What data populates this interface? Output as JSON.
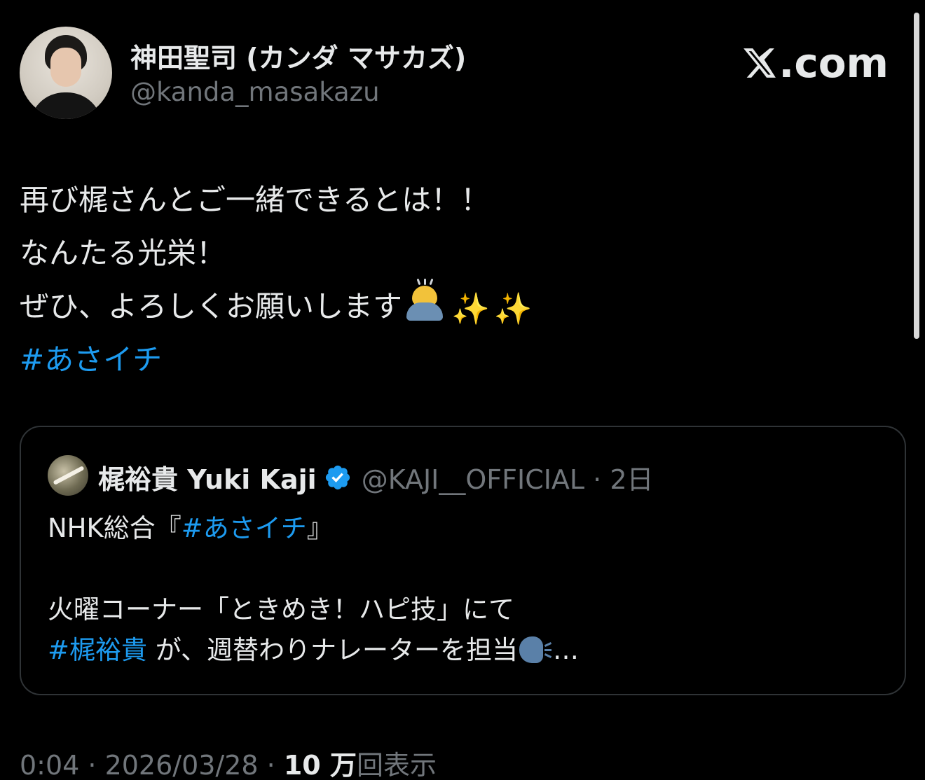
{
  "author": {
    "display_name": "神田聖司 (カンダ マサカズ)",
    "handle": "@kanda_masakazu"
  },
  "brand": {
    "label": ".com"
  },
  "tweet": {
    "lines": [
      "再び梶さんとご一緒できるとは！！",
      "なんたる光栄！",
      "ぜひ、よろしくお願いします"
    ],
    "emoji": [
      "person-bowing",
      "sparkles",
      "sparkles"
    ],
    "sparkle": "✨",
    "hashtag": "#あさイチ"
  },
  "quoted": {
    "name": "梶裕貴 Yuki Kaji",
    "handle_time": "@KAJI__OFFICIAL · 2日",
    "line1_prefix": "NHK総合『",
    "line1_tag": "#あさイチ",
    "line1_suffix": "』",
    "line3": "火曜コーナー「ときめき！ハピ技」にて",
    "line4_tag": "#梶裕貴",
    "line4_text": " が、週替わりナレーターを担当",
    "line4_ellipsis": "…"
  },
  "meta": {
    "time_date": "0:04 · 2026/03/28 · ",
    "views_count": "10 万",
    "views_label": "回表示"
  },
  "colors": {
    "background": "#000000",
    "text": "#e7e9ea",
    "muted": "#71767b",
    "link": "#1d9bf0",
    "border": "#2f3336"
  }
}
